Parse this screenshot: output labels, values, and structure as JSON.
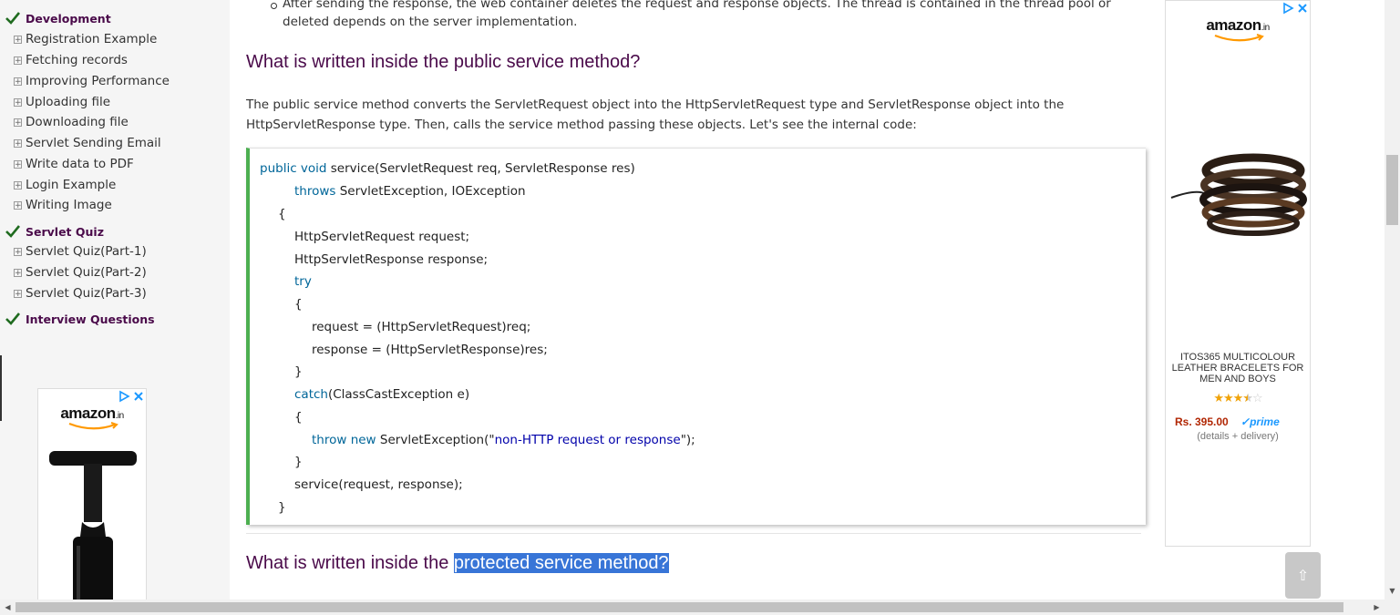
{
  "sidebar": {
    "sections": [
      {
        "label": "Development",
        "items": [
          "Registration Example",
          "Fetching records",
          "Improving Performance",
          "Uploading file",
          "Downloading file",
          "Servlet Sending Email",
          "Write data to PDF",
          "Login Example",
          "Writing Image"
        ]
      },
      {
        "label": "Servlet Quiz",
        "items": [
          "Servlet Quiz(Part-1)",
          "Servlet Quiz(Part-2)",
          "Servlet Quiz(Part-3)"
        ]
      },
      {
        "label": "Interview Questions",
        "items": []
      }
    ],
    "ad": {
      "logo": "amazon",
      "logo_suffix": ".in"
    }
  },
  "main": {
    "bullet": {
      "line1": "After sending the response, the web container deletes the request and response objects. The thread is contained in the thread pool or",
      "line2": "deleted depends on the server implementation."
    },
    "heading1": "What is written inside the public service method?",
    "paragraph": {
      "line1": "The public service method converts the ServletRequest object into the HttpServletRequest type and ServletResponse object into the",
      "line2": "HttpServletResponse type. Then, calls the service method passing these objects. Let's see the internal code:"
    },
    "code": {
      "l1_kw": "public void",
      "l1_rest": " service(ServletRequest req, ServletResponse res)",
      "l2_kw": "throws",
      "l2_rest": " ServletException, IOException",
      "l3": "{",
      "l4": "HttpServletRequest request;",
      "l5": "HttpServletResponse response;",
      "l6_kw": "try",
      "l7": "{",
      "l8": "request = (HttpServletRequest)req;",
      "l9": "response = (HttpServletResponse)res;",
      "l10": "}",
      "l11_kw": "catch",
      "l11_rest": "(ClassCastException e)",
      "l12": "{",
      "l13_kw": "throw new",
      "l13_mid": " ServletException(\"",
      "l13_str": "non-HTTP request or response",
      "l13_end": "\");",
      "l14": "}",
      "l15": "service(request, response);",
      "l16": "}"
    },
    "heading2_plain": "What is written inside the ",
    "heading2_selected": "protected service method?"
  },
  "right_ad": {
    "logo": "amazon",
    "logo_suffix": ".in",
    "product_name": "ITOS365 MULTICOLOUR LEATHER BRACELETS FOR MEN AND BOYS",
    "rating": 3.5,
    "rating_max": 5,
    "price": "Rs. 395.00",
    "prime": "prime",
    "details": "(details + delivery)"
  },
  "scroll_top_label": "⇧",
  "colors": {
    "heading": "#4a0a4a",
    "code_border": "#4caf50",
    "keyword": "#006699",
    "string": "#0000aa",
    "selection": "#3875d7"
  }
}
